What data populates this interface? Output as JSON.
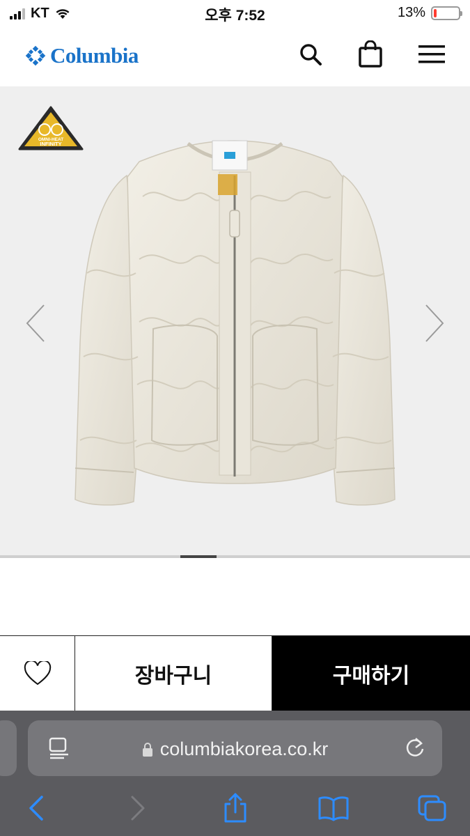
{
  "status_bar": {
    "carrier": "KT",
    "time": "오후 7:52",
    "battery_percent": "13%",
    "battery_level": 0.13
  },
  "header": {
    "logo_text": "Columbia",
    "icons": [
      "search-icon",
      "shopping-bag-icon",
      "menu-icon"
    ]
  },
  "product": {
    "badge_text": [
      "OMNI-HEAT",
      "INFINITY"
    ],
    "image_index": 4,
    "accent_color": "#1a73c9"
  },
  "actions": {
    "cart_label": "장바구니",
    "buy_label": "구매하기"
  },
  "browser": {
    "url": "columbiakorea.co.kr",
    "toolbar": [
      "back-icon",
      "forward-icon",
      "share-icon",
      "bookmarks-icon",
      "tabs-icon"
    ]
  }
}
